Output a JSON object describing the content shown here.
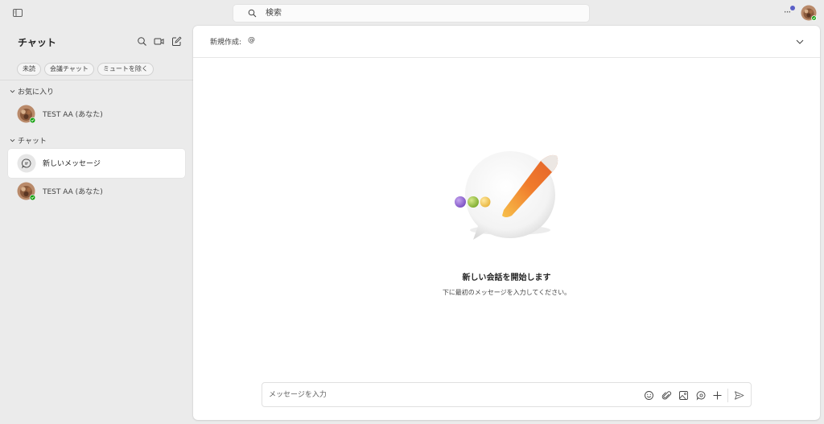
{
  "topbar": {
    "search_placeholder": "検索",
    "more_label": "···"
  },
  "sidebar": {
    "title": "チャット",
    "filters": [
      "未読",
      "会議チャット",
      "ミュートを除く"
    ],
    "sections": [
      {
        "label": "お気に入り"
      },
      {
        "label": "チャット"
      }
    ],
    "items": [
      {
        "name": "TEST AA (あなた)"
      },
      {
        "name": "新しいメッセージ"
      },
      {
        "name": "TEST AA (あなた)"
      }
    ]
  },
  "main": {
    "new_label": "新規作成:",
    "at_sign": "@",
    "empty_title": "新しい会話を開始します",
    "empty_subtitle": "下に最初のメッセージを入力してください。",
    "composer_placeholder": "メッセージを入力"
  },
  "colors": {
    "accent": "#5b5fc7",
    "presence": "#13a10e"
  }
}
